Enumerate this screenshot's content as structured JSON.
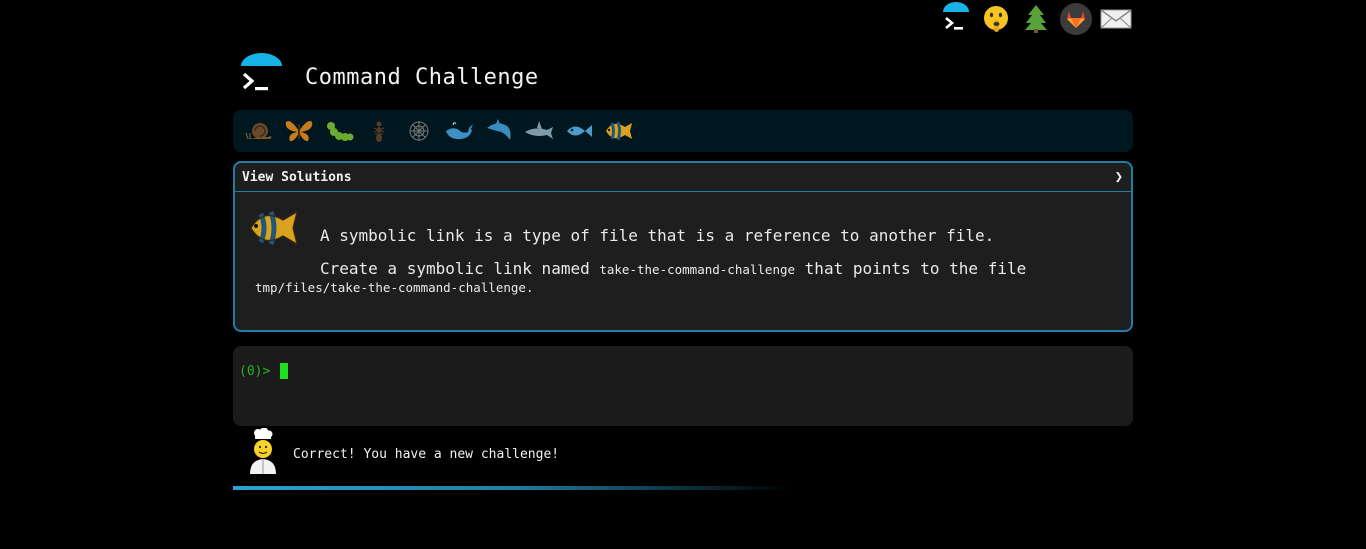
{
  "top_nav": {
    "icons": [
      "terminal-logo-icon",
      "shushing-face-icon",
      "tree-icon",
      "gitlab-icon",
      "mail-icon"
    ]
  },
  "header": {
    "title": "Command Challenge"
  },
  "levels": {
    "icons": [
      "snail-icon",
      "butterfly-icon",
      "caterpillar-icon",
      "ant-icon",
      "spider-web-icon",
      "whale-icon",
      "dolphin-icon",
      "shark-icon",
      "fish-icon",
      "tropical-fish-icon"
    ]
  },
  "challenge": {
    "solutions_label": "View Solutions",
    "chevron": "❯",
    "intro": "A symbolic link is a type of file that is a reference to another file.",
    "task_prefix": "Create a symbolic link named",
    "link_name": "take-the-command-challenge",
    "task_middle": "that points to the file",
    "target_path": "tmp/files/take-the-command-challenge",
    "task_suffix": "."
  },
  "terminal": {
    "prompt": "(0)>"
  },
  "status": {
    "message": "Correct! You have a new challenge!"
  },
  "colors": {
    "accent": "#1f7ea3",
    "prompt": "#22b322",
    "level_bar_bg": "#01171f"
  }
}
